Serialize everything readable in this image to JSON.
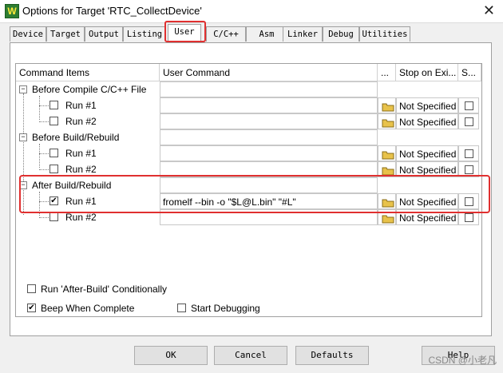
{
  "window": {
    "title": "Options for Target 'RTC_CollectDevice'",
    "app_icon_letter": "W",
    "close_glyph": "✕"
  },
  "tabs": [
    "Device",
    "Target",
    "Output",
    "Listing",
    "User",
    "C/C++",
    "Asm",
    "Linker",
    "Debug",
    "Utilities"
  ],
  "active_tab": "User",
  "grid": {
    "headers": {
      "command_items": "Command Items",
      "user_command": "User Command",
      "browse": "...",
      "stop_on_exit": "Stop on Exi...",
      "s": "S..."
    },
    "groups": [
      {
        "label": "Before Compile C/C++ File",
        "runs": [
          {
            "label": "Run #1",
            "checked": false,
            "command": "",
            "stop": "Not Specified"
          },
          {
            "label": "Run #2",
            "checked": false,
            "command": "",
            "stop": "Not Specified"
          }
        ]
      },
      {
        "label": "Before Build/Rebuild",
        "runs": [
          {
            "label": "Run #1",
            "checked": false,
            "command": "",
            "stop": "Not Specified"
          },
          {
            "label": "Run #2",
            "checked": false,
            "command": "",
            "stop": "Not Specified"
          }
        ]
      },
      {
        "label": "After Build/Rebuild",
        "runs": [
          {
            "label": "Run #1",
            "checked": true,
            "command": "fromelf --bin -o \"$L@L.bin\" \"#L\"",
            "stop": "Not Specified"
          },
          {
            "label": "Run #2",
            "checked": false,
            "command": "",
            "stop": "Not Specified"
          }
        ]
      }
    ]
  },
  "options": {
    "run_after_build": {
      "label": "Run 'After-Build' Conditionally",
      "checked": false
    },
    "beep": {
      "label": "Beep When Complete",
      "checked": true
    },
    "start_debugging": {
      "label": "Start Debugging",
      "checked": false
    }
  },
  "buttons": {
    "ok": "OK",
    "cancel": "Cancel",
    "defaults": "Defaults",
    "help": "Help"
  },
  "watermark": "CSDN @小老凡",
  "colors": {
    "highlight": "#e03030",
    "folder": "#e8c24a"
  }
}
